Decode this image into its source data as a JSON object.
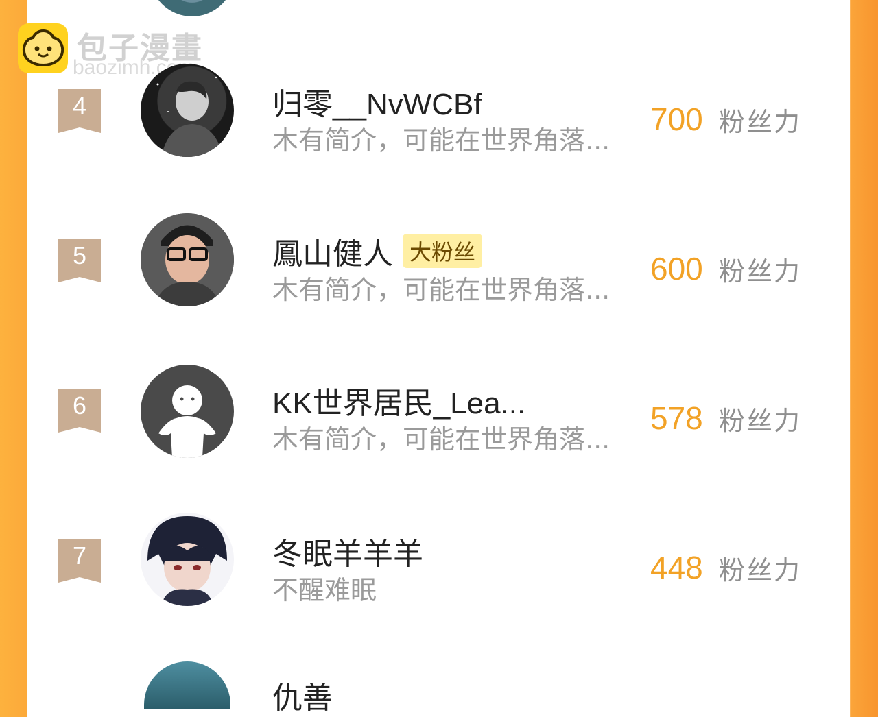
{
  "watermark": {
    "brand": "包子漫畫",
    "url": "baozimh.com"
  },
  "colors": {
    "accent": "#F2A226",
    "rank_badge": "#C9AD93",
    "side_orange": "#FBA53A"
  },
  "unit_label": "粉丝力",
  "fans": [
    {
      "rank": "4",
      "name": "归零__NvWCBf",
      "desc": "木有简介，可能在世界角落...",
      "score": "700",
      "badge": ""
    },
    {
      "rank": "5",
      "name": "鳳山健人",
      "desc": "木有简介，可能在世界角落...",
      "score": "600",
      "badge": "大粉丝"
    },
    {
      "rank": "6",
      "name": "KK世界居民_Lea...",
      "desc": "木有简介，可能在世界角落...",
      "score": "578",
      "badge": ""
    },
    {
      "rank": "7",
      "name": "冬眠羊羊羊",
      "desc": "不醒难眠",
      "score": "448",
      "badge": ""
    }
  ],
  "next_partial_name": "仇善"
}
